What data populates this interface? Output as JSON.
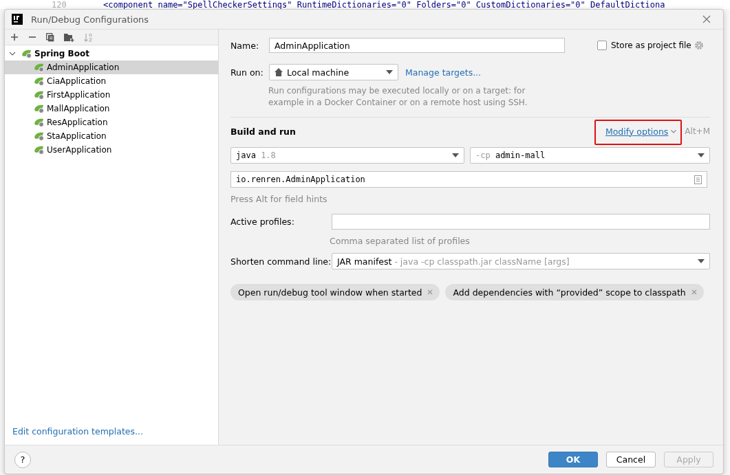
{
  "background_editor": {
    "line_number": "120",
    "code": "<component name=\"SpellCheckerSettings\" RuntimeDictionaries=\"0\" Folders=\"0\" CustomDictionaries=\"0\" DefaultDictiona"
  },
  "window": {
    "title": "Run/Debug Configurations"
  },
  "tree": {
    "label": "Spring Boot",
    "expanded": true,
    "children": [
      {
        "label": "AdminApplication",
        "selected": true
      },
      {
        "label": "CiaApplication",
        "selected": false
      },
      {
        "label": "FirstApplication",
        "selected": false
      },
      {
        "label": "MallApplication",
        "selected": false
      },
      {
        "label": "ResApplication",
        "selected": false
      },
      {
        "label": "StaApplication",
        "selected": false
      },
      {
        "label": "UserApplication",
        "selected": false
      }
    ]
  },
  "templates_link": "Edit configuration templates...",
  "name": {
    "label": "Name:",
    "value": "AdminApplication"
  },
  "store_as_project_file": {
    "label": "Store as project file",
    "checked": false
  },
  "run_on": {
    "label": "Run on:",
    "value": "Local machine",
    "link": "Manage targets...",
    "description": "Run configurations may be executed locally or on a target: for example in a Docker Container or on a remote host using SSH."
  },
  "build_and_run": {
    "title": "Build and run",
    "modify_options": "Modify options",
    "highlighted": true,
    "shortcut": "Alt+M",
    "jdk": {
      "value": "java",
      "version": "1.8"
    },
    "classpath": {
      "prefix": "-cp",
      "value": "admin-mall"
    },
    "main_class": "io.renren.AdminApplication",
    "hint": "Press Alt for field hints"
  },
  "active_profiles": {
    "label": "Active profiles:",
    "hint": "Comma separated list of profiles"
  },
  "shorten_command_line": {
    "label": "Shorten command line:",
    "value": "JAR manifest",
    "detail": "- java -cp classpath.jar className [args]"
  },
  "options": [
    "Open run/debug tool window when started",
    "Add dependencies with “provided” scope to classpath"
  ],
  "help_button": "?",
  "buttons": [
    {
      "label": "OK",
      "kind": "primary",
      "disabled": false
    },
    {
      "label": "Cancel",
      "kind": "normal",
      "disabled": false
    },
    {
      "label": "Apply",
      "kind": "normal",
      "disabled": true
    }
  ]
}
